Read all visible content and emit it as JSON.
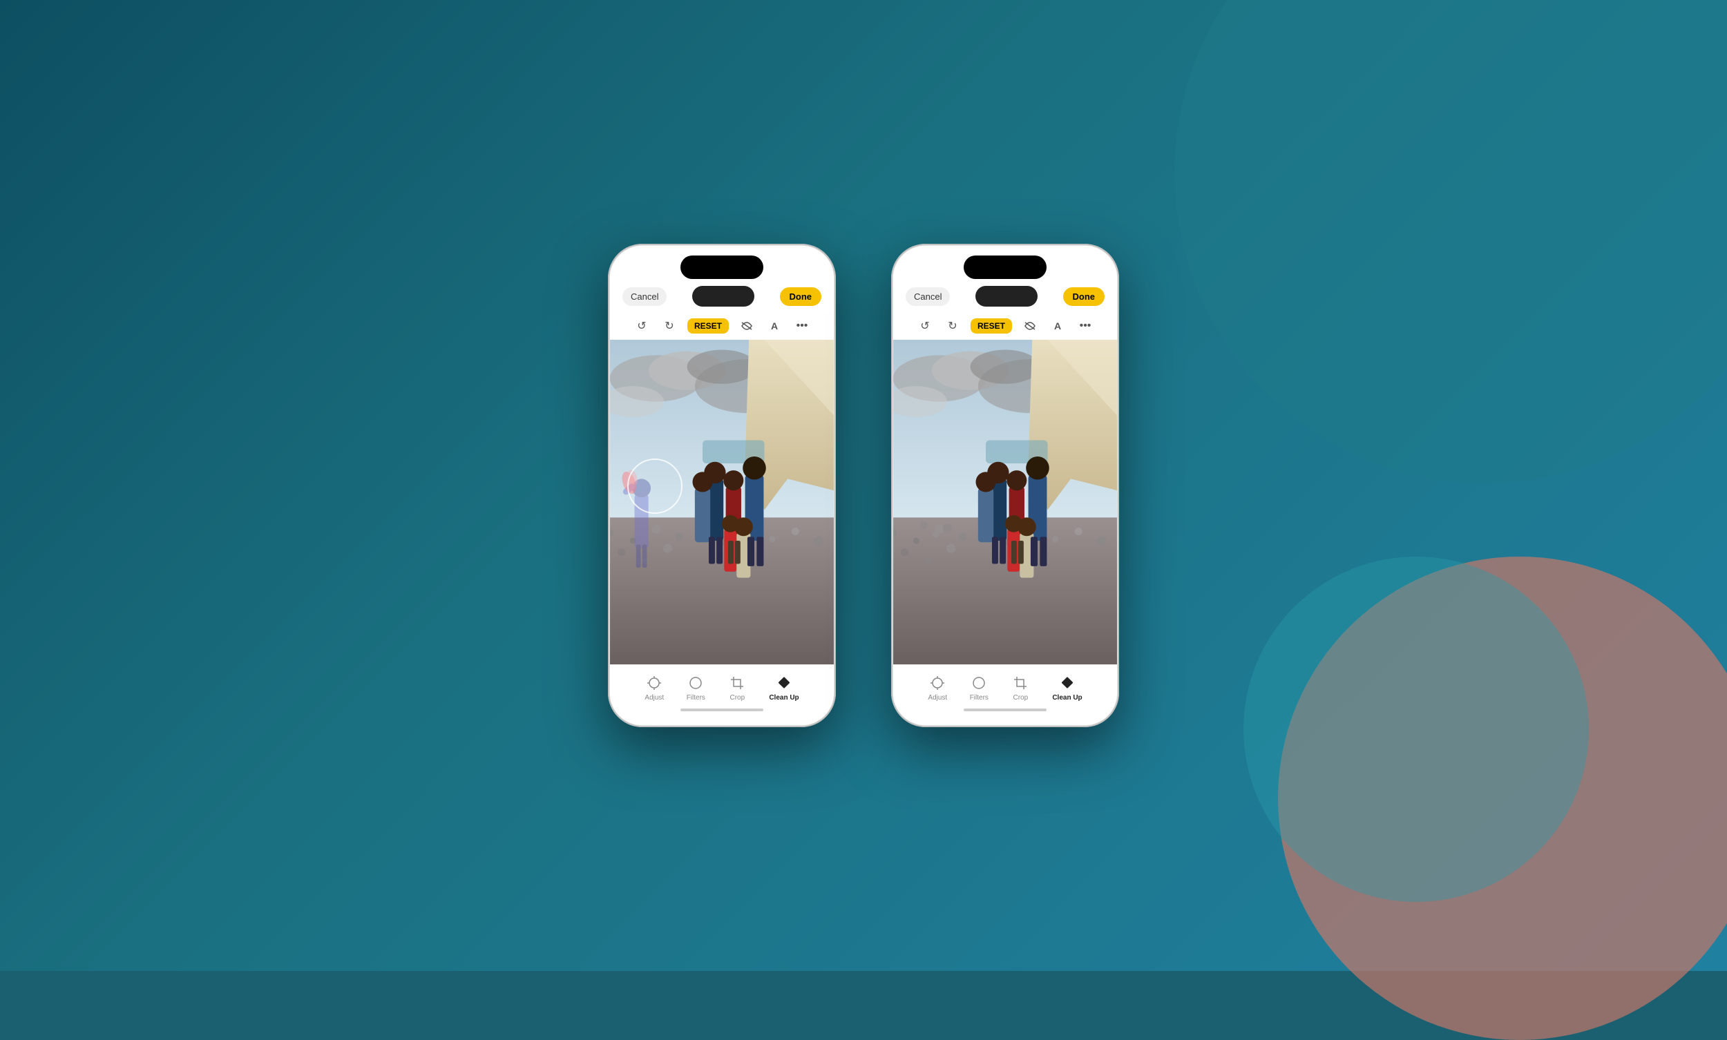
{
  "background": {
    "color": "#1a6070"
  },
  "phones": [
    {
      "id": "phone-left",
      "topBar": {
        "cancel": "Cancel",
        "middle": "",
        "done": "Done"
      },
      "toolbar": {
        "reset": "RESET"
      },
      "hasGhostPerson": true,
      "hasBrushCircle": true,
      "bottomTabs": [
        {
          "id": "adjust",
          "label": "Adjust",
          "icon": "sun",
          "active": false
        },
        {
          "id": "filters",
          "label": "Filters",
          "icon": "circle-half",
          "active": false
        },
        {
          "id": "crop",
          "label": "Crop",
          "icon": "crop",
          "active": false
        },
        {
          "id": "cleanup",
          "label": "Clean Up",
          "icon": "diamond",
          "active": true
        }
      ]
    },
    {
      "id": "phone-right",
      "topBar": {
        "cancel": "Cancel",
        "middle": "",
        "done": "Done"
      },
      "toolbar": {
        "reset": "RESET"
      },
      "hasGhostPerson": false,
      "hasBrushCircle": false,
      "bottomTabs": [
        {
          "id": "adjust",
          "label": "Adjust",
          "icon": "sun",
          "active": false
        },
        {
          "id": "filters",
          "label": "Filters",
          "icon": "circle-half",
          "active": false
        },
        {
          "id": "crop",
          "label": "Crop",
          "icon": "crop",
          "active": false
        },
        {
          "id": "cleanup",
          "label": "Clean Up",
          "icon": "diamond",
          "active": true
        }
      ]
    }
  ]
}
